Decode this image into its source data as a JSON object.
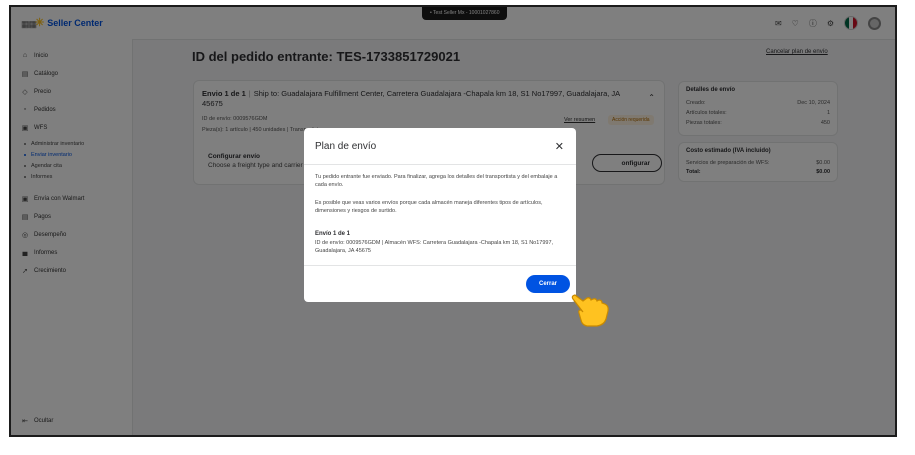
{
  "topbar": {
    "brand": "Seller Center",
    "test_label": "• Test Seller Mx - 10001027860"
  },
  "sidebar": {
    "items": [
      {
        "label": "Inicio",
        "icon": "home-icon"
      },
      {
        "label": "Catálogo",
        "icon": "catalog-icon"
      },
      {
        "label": "Precio",
        "icon": "price-tag-icon"
      },
      {
        "label": "Pedidos",
        "icon": "orders-icon"
      },
      {
        "label": "WFS",
        "icon": "truck-icon"
      },
      {
        "label": "Envía con Walmart",
        "icon": "shipping-icon"
      },
      {
        "label": "Pagos",
        "icon": "payments-icon"
      },
      {
        "label": "Desempeño",
        "icon": "performance-icon"
      },
      {
        "label": "Informes",
        "icon": "reports-icon"
      },
      {
        "label": "Crecimiento",
        "icon": "growth-icon"
      }
    ],
    "wfs_sub": [
      {
        "label": "Administrar inventario"
      },
      {
        "label": "Enviar inventario"
      },
      {
        "label": "Agendar cita"
      },
      {
        "label": "Informes"
      }
    ],
    "collapse_label": "Ocultar"
  },
  "page": {
    "title": "ID del pedido entrante: TES-1733851729021",
    "cancel_link": "Cancelar plan de envío"
  },
  "shipment": {
    "title": "Envio 1 de 1",
    "ship_to": "Ship to: Guadalajara Fulfillment Center, Carretera Guadalajara -Chapala km 18, S1 No17997, Guadalajara, JA 45675",
    "ship_id": "ID de envío: 0009576GDM",
    "pieces": "Pieza(s): 1 artículo | 450 unidades | Transportista: --",
    "ver_resumen": "Ver resumen",
    "action_badge": "Acción requerida",
    "config_title": "Configurar envío",
    "config_sub": "Choose a freight type and carrier t",
    "config_button": "onfigurar"
  },
  "details": {
    "title": "Detalles de envío",
    "rows": [
      {
        "label": "Creado:",
        "value": "Dec 10, 2024"
      },
      {
        "label": "Artículos totales:",
        "value": "1"
      },
      {
        "label": "Piezas totales:",
        "value": "450"
      }
    ]
  },
  "cost": {
    "title": "Costo estimado (IVA incluido)",
    "rows": [
      {
        "label": "Servicios de preparación de WFS:",
        "value": "$0.00"
      },
      {
        "label": "Total:",
        "value": "$0.00"
      }
    ]
  },
  "modal": {
    "title": "Plan de envío",
    "p1": "Tu pedido entrante fue enviado. Para finalizar, agrega los detalles del transportista y del embalaje a cada envío.",
    "p2": "Es posible que veas varios envíos porque cada almacén maneja diferentes tipos de artículos, dimensiones y riesgos de surtido.",
    "ship_title": "Envío 1 de 1",
    "ship_detail": "ID de envío: 0009576GDM | Almacén WFS: Carretera Guadalajara -Chapala km 18, S1 No17997, Guadalajara, JA 45675",
    "close_button": "Cerrar"
  },
  "colors": {
    "brand_blue": "#0053e2",
    "spark_yellow": "#ffc220"
  }
}
